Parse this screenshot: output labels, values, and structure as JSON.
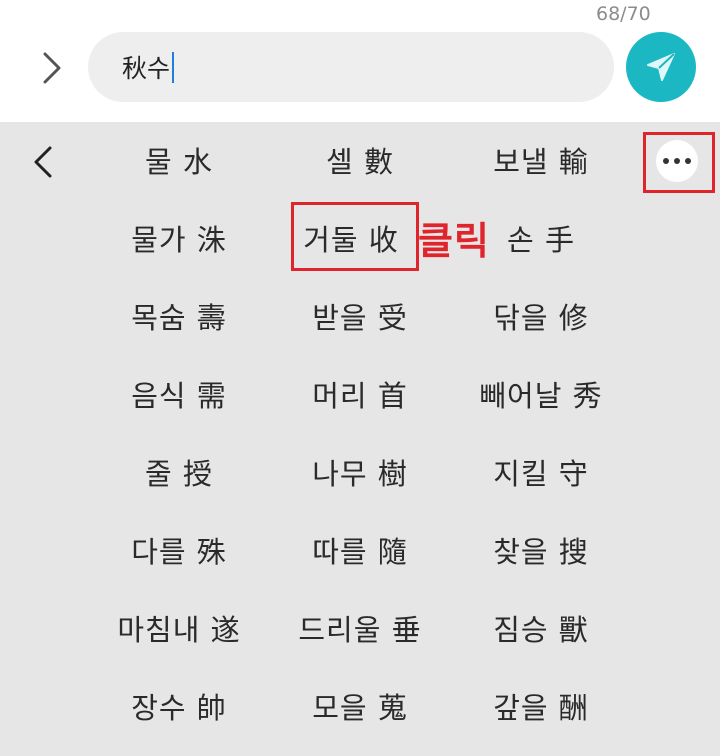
{
  "input_bar": {
    "counter": "68/70",
    "text": "秋수"
  },
  "colors": {
    "send_button": "#1bb8c4",
    "panel_bg": "#e6e6e6",
    "highlight": "#e0242c"
  },
  "candidates": [
    [
      "물 水",
      "셀 數",
      "보낼 輸"
    ],
    [
      "물가 洙",
      "거둘 收",
      "손 手"
    ],
    [
      "목숨 壽",
      "받을 受",
      "닦을 修"
    ],
    [
      "음식 需",
      "머리 首",
      "빼어날 秀"
    ],
    [
      "줄 授",
      "나무 樹",
      "지킬 守"
    ],
    [
      "다를 殊",
      "따를 隨",
      "찾을 搜"
    ],
    [
      "마침내 遂",
      "드리울 垂",
      "짐승 獸"
    ],
    [
      "장수 帥",
      "모을 蒐",
      "갚을 酬"
    ]
  ],
  "annotation": {
    "label": "클릭"
  },
  "icons": {
    "expand": "chevron-right-icon",
    "send": "send-icon",
    "back": "chevron-left-icon",
    "more": "more-horizontal-icon"
  }
}
